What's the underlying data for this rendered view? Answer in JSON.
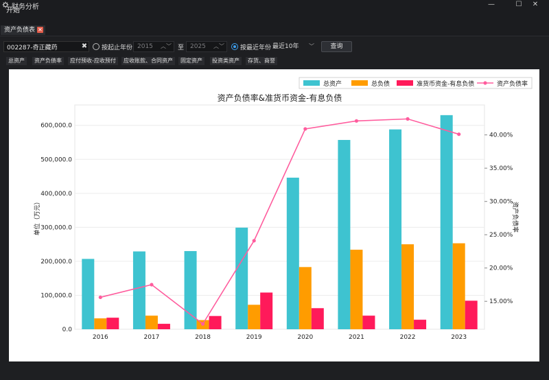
{
  "window": {
    "title": "财务分析",
    "icon": "gear-icon",
    "minimize_glyph": "—",
    "maximize_glyph": "☐",
    "close_glyph": "✕"
  },
  "menu": {
    "start": "开始"
  },
  "doc_tab": {
    "label": "资产负债表",
    "close_glyph": "✕"
  },
  "toolbar": {
    "stock_value": "002287-奇正藏药",
    "clear_glyph": "✖",
    "by_year_label": "按起止年份",
    "start_year": "2015",
    "to_label": "至",
    "end_year": "2025",
    "recent_label": "按最近年份",
    "recent_value": "最近10年",
    "recent_selected": true,
    "query_label": "查询"
  },
  "subtabs": [
    "总资产",
    "资产负债率",
    "应付预收-应收预付",
    "应收账款、合同资产",
    "固定资产",
    "投资类资产",
    "存货、商誉"
  ],
  "colors": {
    "total_assets": "#3ec3d0",
    "total_liabilities": "#ff9c00",
    "cash_minus_debt": "#ff1a5a",
    "debt_ratio": "#ff5c9d"
  },
  "chart_data": {
    "type": "bar",
    "title": "资产负债率&准货币资金-有息负债",
    "categories": [
      "2016",
      "2017",
      "2018",
      "2019",
      "2020",
      "2021",
      "2022",
      "2023"
    ],
    "ylabel": "单位（万元）",
    "y2label": "资产负债率",
    "ylim": [
      0,
      660000
    ],
    "y2lim": [
      10.8,
      44.5
    ],
    "yticks": [
      "0.0",
      "100,000.0",
      "200,000.0",
      "300,000.0",
      "400,000.0",
      "500,000.0",
      "600,000.0"
    ],
    "y2ticks": [
      "15.00%",
      "20.00%",
      "25.00%",
      "30.00%",
      "35.00%",
      "40.00%"
    ],
    "legend_position": "top-right",
    "series": [
      {
        "name": "总资产",
        "type": "bar",
        "values": [
          207000,
          229000,
          230000,
          299000,
          446000,
          557000,
          588000,
          630000
        ]
      },
      {
        "name": "总负债",
        "type": "bar",
        "values": [
          32000,
          40000,
          27000,
          72000,
          183000,
          234000,
          250000,
          253000
        ]
      },
      {
        "name": "准货币资金-有息负债",
        "type": "bar",
        "values": [
          34000,
          16000,
          39000,
          108000,
          62000,
          40000,
          28000,
          84000
        ]
      },
      {
        "name": "资产负债率",
        "type": "line",
        "axis": "right",
        "values": [
          15.6,
          17.5,
          11.6,
          24.1,
          40.9,
          42.1,
          42.4,
          40.1
        ]
      }
    ]
  }
}
